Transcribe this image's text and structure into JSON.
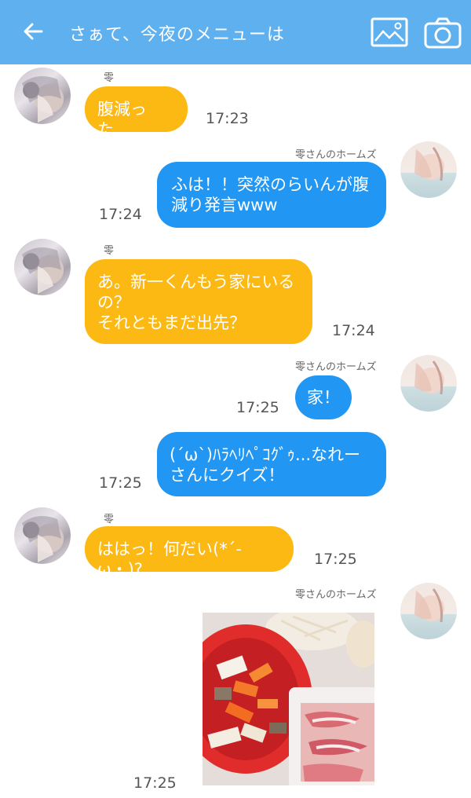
{
  "header": {
    "title": "さぁて、今夜のメニューは",
    "back_icon": "arrow-left-icon",
    "gallery_icon": "image-icon",
    "camera_icon": "camera-icon",
    "background": "#5fb0ef"
  },
  "colors": {
    "left_bubble": "#fdb913",
    "right_bubble": "#2196f3"
  },
  "messages": [
    {
      "side": "left",
      "sender": "零",
      "text": "腹減った…",
      "time": "17:23"
    },
    {
      "side": "right",
      "sender": "零さんのホームズ",
      "text": "ふは！！突然のらいんが腹減り発言www",
      "time": "17:24"
    },
    {
      "side": "left",
      "sender": "零",
      "text": "あ。新一くんもう家にいるの？\nそれともまだ出先？",
      "time": "17:24"
    },
    {
      "side": "right",
      "sender": "零さんのホームズ",
      "text": "家！",
      "time": "17:25"
    },
    {
      "side": "right",
      "sender": "",
      "text": "(ˊωˋ)ﾊﾗﾍﾘﾍﾟｺｸﾞｩ...なれーさんにクイズ！",
      "time": "17:25"
    },
    {
      "side": "left",
      "sender": "零",
      "text": "ははっ！何だい(*´-ω・)?",
      "time": "17:25"
    },
    {
      "side": "right",
      "sender": "零さんのホームズ",
      "text": "",
      "time": "17:25",
      "image": "food-photo"
    }
  ]
}
